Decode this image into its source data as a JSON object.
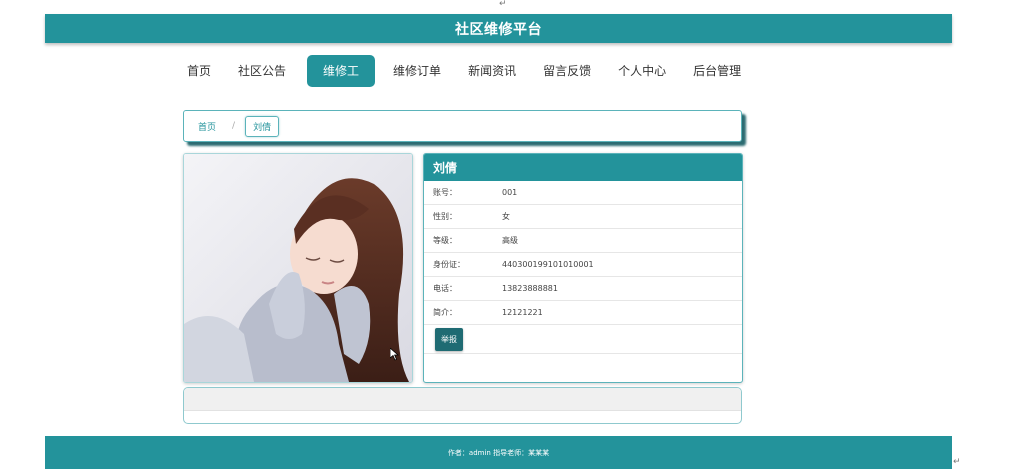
{
  "doc_marks": {
    "top": "↵",
    "bottom": "↵"
  },
  "header": {
    "title": "社区维修平台"
  },
  "nav": {
    "items": [
      {
        "label": "首页",
        "active": false
      },
      {
        "label": "社区公告",
        "active": false
      },
      {
        "label": "维修工",
        "active": true
      },
      {
        "label": "维修订单",
        "active": false
      },
      {
        "label": "新闻资讯",
        "active": false
      },
      {
        "label": "留言反馈",
        "active": false
      },
      {
        "label": "个人中心",
        "active": false
      },
      {
        "label": "后台管理",
        "active": false
      }
    ]
  },
  "breadcrumb": {
    "home": "首页",
    "separator": "/",
    "current": "刘倩"
  },
  "profile": {
    "name": "刘倩",
    "fields": [
      {
        "label": "账号：",
        "value": "001"
      },
      {
        "label": "性别：",
        "value": "女"
      },
      {
        "label": "等级：",
        "value": "高级"
      },
      {
        "label": "身份证：",
        "value": "440300199101010001"
      },
      {
        "label": "电话：",
        "value": "13823888881"
      },
      {
        "label": "简介：",
        "value": "12121221"
      }
    ],
    "action_label": "举报"
  },
  "footer": {
    "text": "作者：admin 指导老师：某某某"
  },
  "colors": {
    "primary": "#23939b",
    "button": "#1f6b73"
  }
}
